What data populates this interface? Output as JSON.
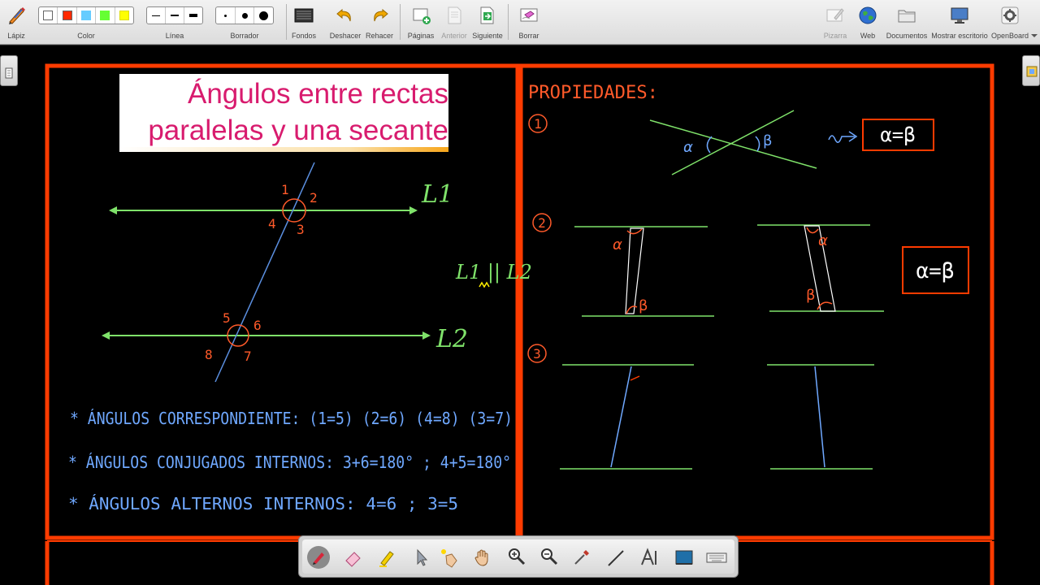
{
  "toolbar": {
    "items": [
      {
        "label": "Lápiz",
        "icon": "pencil-icon"
      },
      {
        "label": "Color",
        "icon": "color-palette"
      },
      {
        "label": "Línea",
        "icon": "line-width-selector"
      },
      {
        "label": "Borrador",
        "icon": "eraser-size-selector"
      },
      {
        "label": "Fondos",
        "icon": "backgrounds-icon"
      },
      {
        "label": "Deshacer",
        "icon": "undo-icon"
      },
      {
        "label": "Rehacer",
        "icon": "redo-icon"
      },
      {
        "label": "Páginas",
        "icon": "pages-icon"
      },
      {
        "label": "Anterior",
        "icon": "previous-icon"
      },
      {
        "label": "Siguiente",
        "icon": "next-icon"
      },
      {
        "label": "Borrar",
        "icon": "erase-page-icon"
      },
      {
        "label": "Pizarra",
        "icon": "board-icon"
      },
      {
        "label": "Web",
        "icon": "globe-icon"
      },
      {
        "label": "Documentos",
        "icon": "folder-icon"
      },
      {
        "label": "Mostrar escritorio",
        "icon": "desktop-icon"
      },
      {
        "label": "OpenBoard",
        "icon": "gear-icon"
      }
    ],
    "colors": [
      "#ffffff",
      "#ff2a00",
      "#66ccff",
      "#66ff33",
      "#ffff00"
    ]
  },
  "board": {
    "title_line1": "Ángulos entre rectas",
    "title_line2": "paralelas y una secante",
    "left": {
      "line_labels": [
        "L1",
        "L2"
      ],
      "parallel_note": "L1 || L2",
      "angle_numbers": [
        "1",
        "2",
        "3",
        "4",
        "5",
        "6",
        "7",
        "8"
      ],
      "notes": [
        "* ÁNGULOS CORRESPONDIENTE: (1=5) (2=6) (4=8) (3=7)",
        "* ÁNGULOS CONJUGADOS INTERNOS: 3+6=180° ; 4+5=180°",
        "* ÁNGULOS ALTERNOS INTERNOS: 4=6 ; 3=5"
      ]
    },
    "right": {
      "heading": "PROPIEDADES:",
      "items": [
        "1",
        "2",
        "3"
      ],
      "alpha": "α",
      "beta": "β",
      "result1": "α=β",
      "result2": "α=β"
    }
  },
  "floatbar": {
    "tools": [
      "pen-icon",
      "eraser-icon",
      "highlighter-icon",
      "pointer-icon",
      "laser-pointer-icon",
      "hand-icon",
      "zoom-in-icon",
      "zoom-out-icon",
      "pipette-icon",
      "line-tool-icon",
      "text-tool-icon",
      "capture-icon",
      "keyboard-icon"
    ]
  }
}
